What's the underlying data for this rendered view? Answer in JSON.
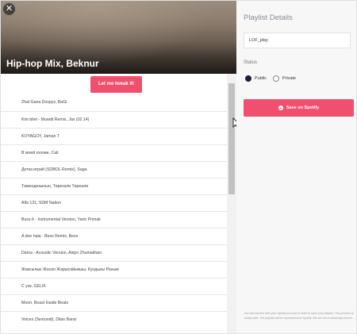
{
  "hero": {
    "close_glyph": "✕",
    "title": "Hip-hop Mix, Beknur"
  },
  "actions": {
    "tweak_label": "Let me tweak it!"
  },
  "tracks": [
    "Zhal Gana Dospyz, BaGi",
    "Kim bilet - Muratti Remix, Jax (02.14)",
    "KOYAGOY, Jaman T",
    "В моей голове, Cali",
    "Детка играй (SOBOL Remix), Saga",
    "Төмендезынын, Төрегали Төреали",
    "Alfa 131, SDM Nation",
    "Buss It - Instrumental Version, Yarin Primak",
    "A don hala - Bess Remix, Bess",
    "Dama - Acoustic Version, Aidyn Zhumakhan",
    "Жаксылык Жасап Жарысайыкшы, Кундызы Рахым",
    "С уэк, GELIK",
    "Moon, Beast Inside Beats",
    "Voices (Sextunid), Dilan Banzi"
  ],
  "details": {
    "heading": "Playlist Details",
    "name_value": "LOF_play",
    "status_label": "Status",
    "public_label": "Public",
    "private_label": "Private",
    "selected": "Public",
    "save_label": "Save on Spotify",
    "disclaimer": "You will connect with your Spotify account in order to save your playlist. This process is totally safe. The playlist will be reproduced on Spotify. We are not a streaming service."
  },
  "colors": {
    "accent": "#f0506e",
    "radio_checked": "#1c1c3c",
    "heading": "#8a8a9a"
  },
  "icons": {
    "close": "close-icon",
    "save": "spotify-icon",
    "cursor": "mouse-pointer-icon"
  }
}
